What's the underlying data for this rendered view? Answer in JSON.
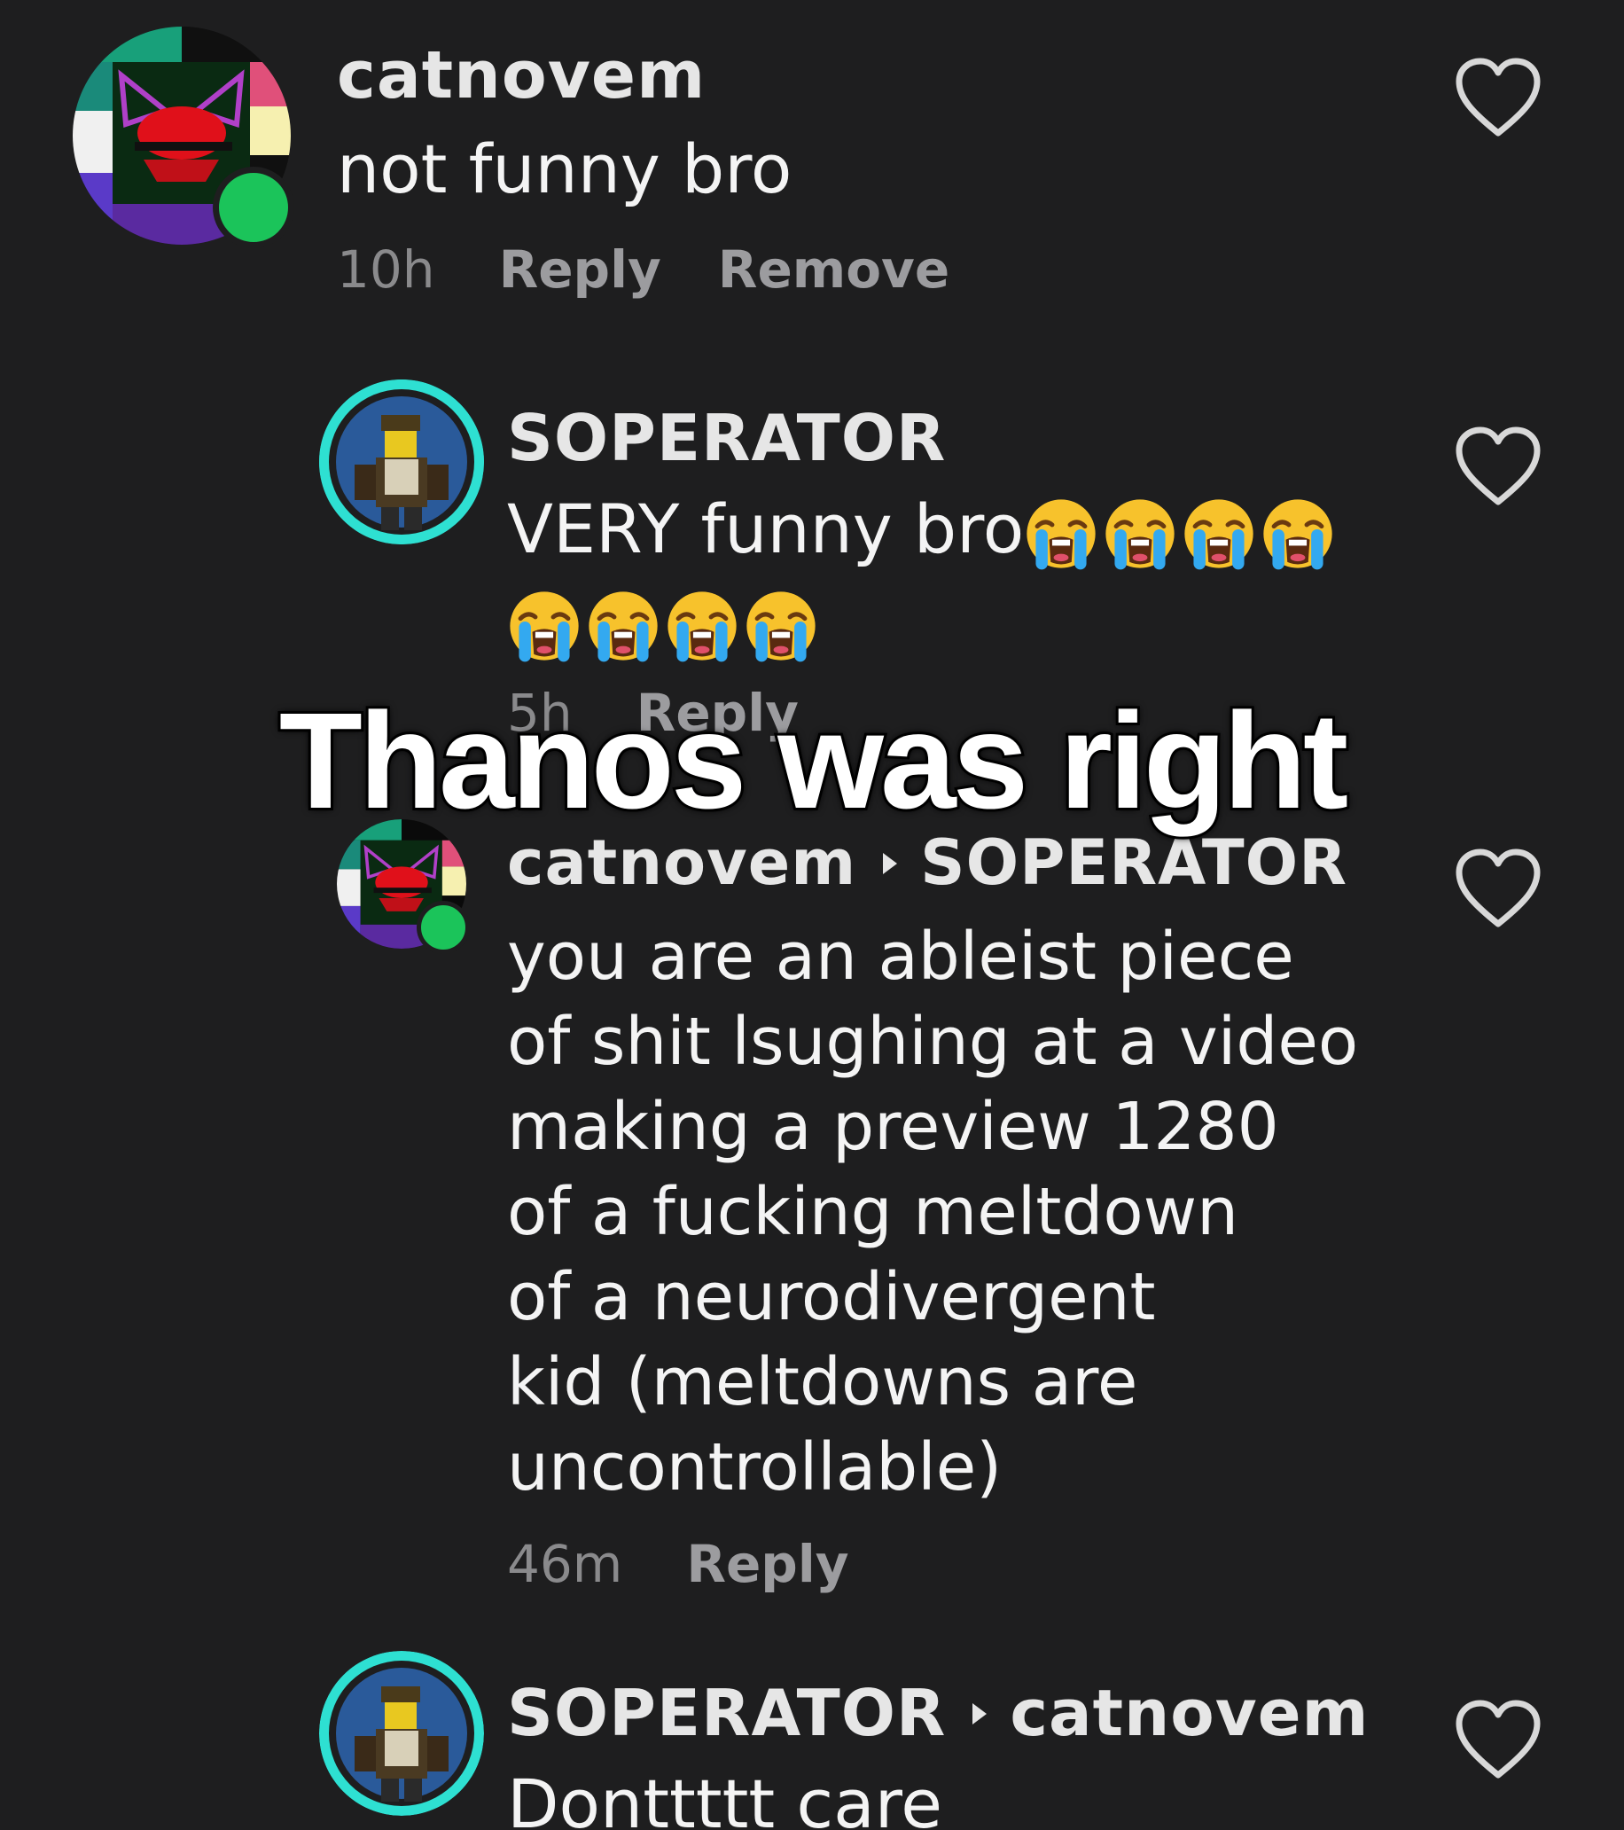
{
  "comments": [
    {
      "author": "catnovem",
      "text": "not funny bro",
      "time": "10h",
      "reply_label": "Reply",
      "remove_label": "Remove"
    },
    {
      "author": "SOPERATOR",
      "text_line1": "VERY funny bro",
      "emoji_name": "loudly-crying-face",
      "emoji_count_line1": 4,
      "emoji_count_line2": 4,
      "time": "5h",
      "reply_label": "Reply"
    },
    {
      "author": "catnovem",
      "reply_to": "SOPERATOR",
      "text_lines": [
        "you are an ableist piece",
        "of shit lsughing at a video",
        "making a preview 1280",
        "of a fucking meltdown",
        "of a neurodivergent",
        "kid (meltdowns are",
        "uncontrollable)"
      ],
      "time": "46m",
      "reply_label": "Reply"
    },
    {
      "author": "SOPERATOR",
      "reply_to": "catnovem",
      "text": "Donttttt care"
    }
  ],
  "overlay_caption": "Thanos was right",
  "icons": {
    "like": "heart-outline-icon",
    "reply_arrow": "caret-right-icon"
  },
  "colors": {
    "background": "#1e1e1f",
    "online": "#1bc45a",
    "avatar_ring": "#2ee0d2"
  }
}
